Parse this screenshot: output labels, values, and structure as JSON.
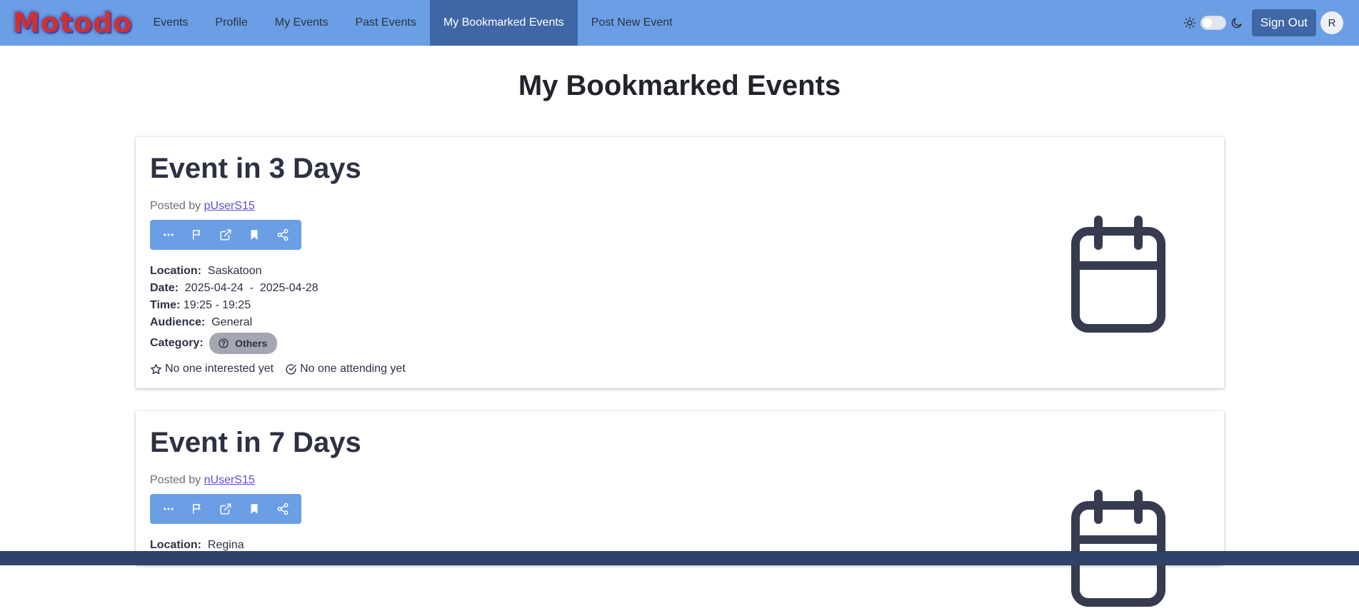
{
  "brand": {
    "logo_text": "Motodo"
  },
  "nav": {
    "items": [
      {
        "label": "Events",
        "active": false
      },
      {
        "label": "Profile",
        "active": false
      },
      {
        "label": "My Events",
        "active": false
      },
      {
        "label": "Past Events",
        "active": false
      },
      {
        "label": "My Bookmarked Events",
        "active": true
      },
      {
        "label": "Post New Event",
        "active": false
      }
    ],
    "sign_out_label": "Sign Out",
    "avatar_initial": "R",
    "theme_toggle_on": false
  },
  "page": {
    "title": "My Bookmarked Events"
  },
  "labels": {
    "posted_by": "Posted by",
    "location": "Location:",
    "date": "Date:",
    "time": "Time:",
    "audience": "Audience:",
    "category": "Category:"
  },
  "events": [
    {
      "title": "Event in 3 Days",
      "author": "pUserS15",
      "location": "Saskatoon",
      "date_start": "2025-04-24",
      "date_sep": "-",
      "date_end": "2025-04-28",
      "time": "19:25 - 19:25",
      "audience": "General",
      "category": "Others",
      "interested": "No one interested yet",
      "attending": "No one attending yet"
    },
    {
      "title": "Event in 7 Days",
      "author": "nUserS15",
      "location": "Regina"
    }
  ],
  "colors": {
    "navbar": "#6a9fe5",
    "nav_active": "#3f67a6",
    "footer": "#2f4368",
    "text": "#2d3142"
  }
}
